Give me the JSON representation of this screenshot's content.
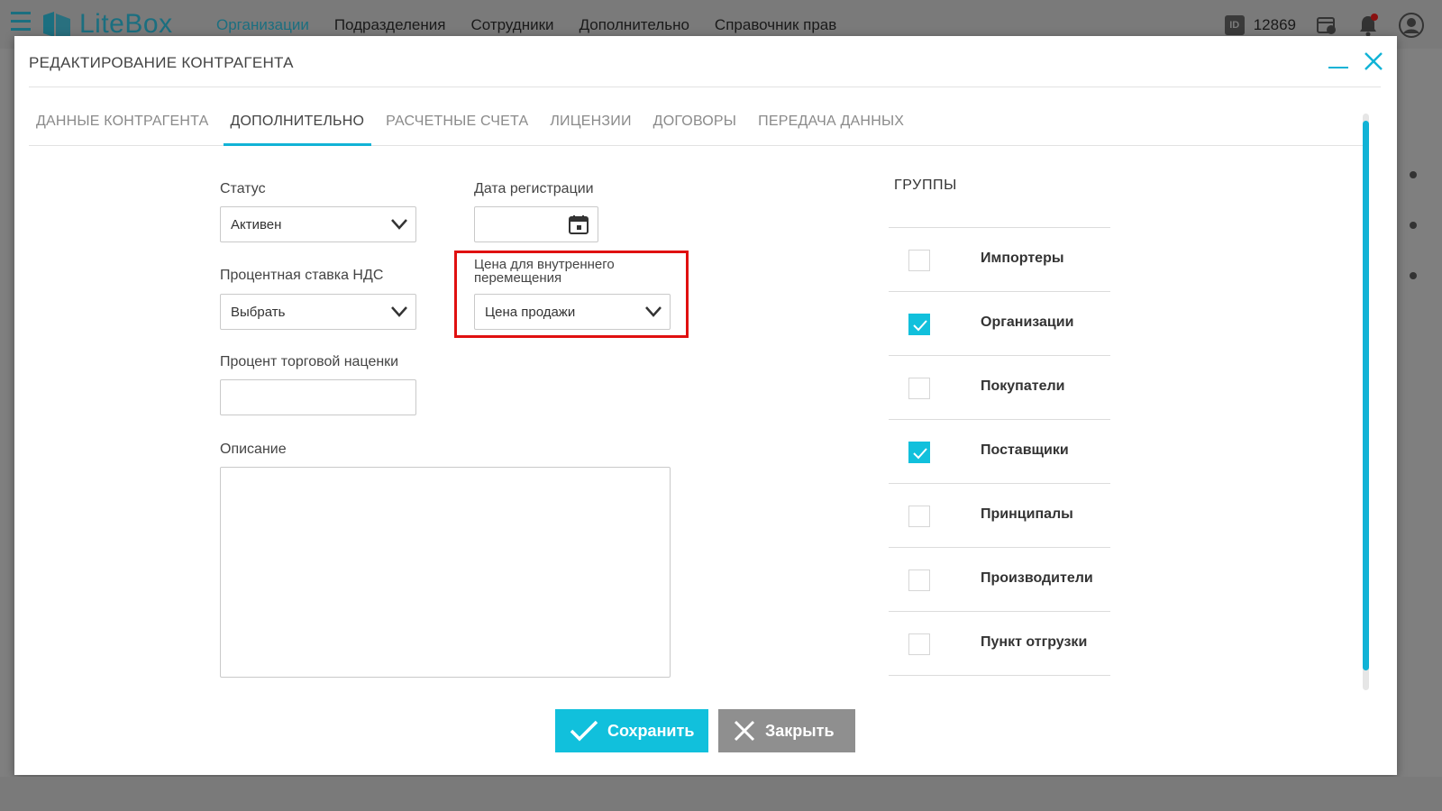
{
  "app": {
    "logo_text": "LiteBox",
    "nav": [
      "Организации",
      "Подразделения",
      "Сотрудники",
      "Дополнительно",
      "Справочник прав"
    ],
    "active_nav": 0,
    "account_id_badge": "ID",
    "account_id": "12869",
    "colors": {
      "accent": "#11c0dc",
      "brand": "#1b6f80",
      "highlight": "#e01010"
    }
  },
  "modal": {
    "title": "РЕДАКТИРОВАНИЕ КОНТРАГЕНТА",
    "tabs": [
      {
        "label": "ДАННЫЕ КОНТРАГЕНТА",
        "active": false
      },
      {
        "label": "ДОПОЛНИТЕЛЬНО",
        "active": true
      },
      {
        "label": "РАСЧЕТНЫЕ СЧЕТА",
        "active": false
      },
      {
        "label": "ЛИЦЕНЗИИ",
        "active": false
      },
      {
        "label": "ДОГОВОРЫ",
        "active": false
      },
      {
        "label": "ПЕРЕДАЧА ДАННЫХ",
        "active": false
      }
    ]
  },
  "form": {
    "status": {
      "label": "Статус",
      "value": "Активен"
    },
    "registration_date": {
      "label": "Дата регистрации",
      "value": ""
    },
    "vat_rate": {
      "label": "Процентная ставка НДС",
      "value": "Выбрать"
    },
    "internal_price": {
      "label": "Цена для внутреннего перемещения",
      "value": "Цена продажи"
    },
    "markup_percent": {
      "label": "Процент торговой наценки",
      "value": ""
    },
    "description": {
      "label": "Описание",
      "value": ""
    }
  },
  "groups": {
    "title": "ГРУППЫ",
    "items": [
      {
        "label": "Импортеры",
        "checked": false
      },
      {
        "label": "Организации",
        "checked": true
      },
      {
        "label": "Покупатели",
        "checked": false
      },
      {
        "label": "Поставщики",
        "checked": true
      },
      {
        "label": "Принципалы",
        "checked": false
      },
      {
        "label": "Производители",
        "checked": false
      },
      {
        "label": "Пункт отгрузки",
        "checked": false
      }
    ]
  },
  "actions": {
    "save_label": "Сохранить",
    "close_label": "Закрыть"
  }
}
